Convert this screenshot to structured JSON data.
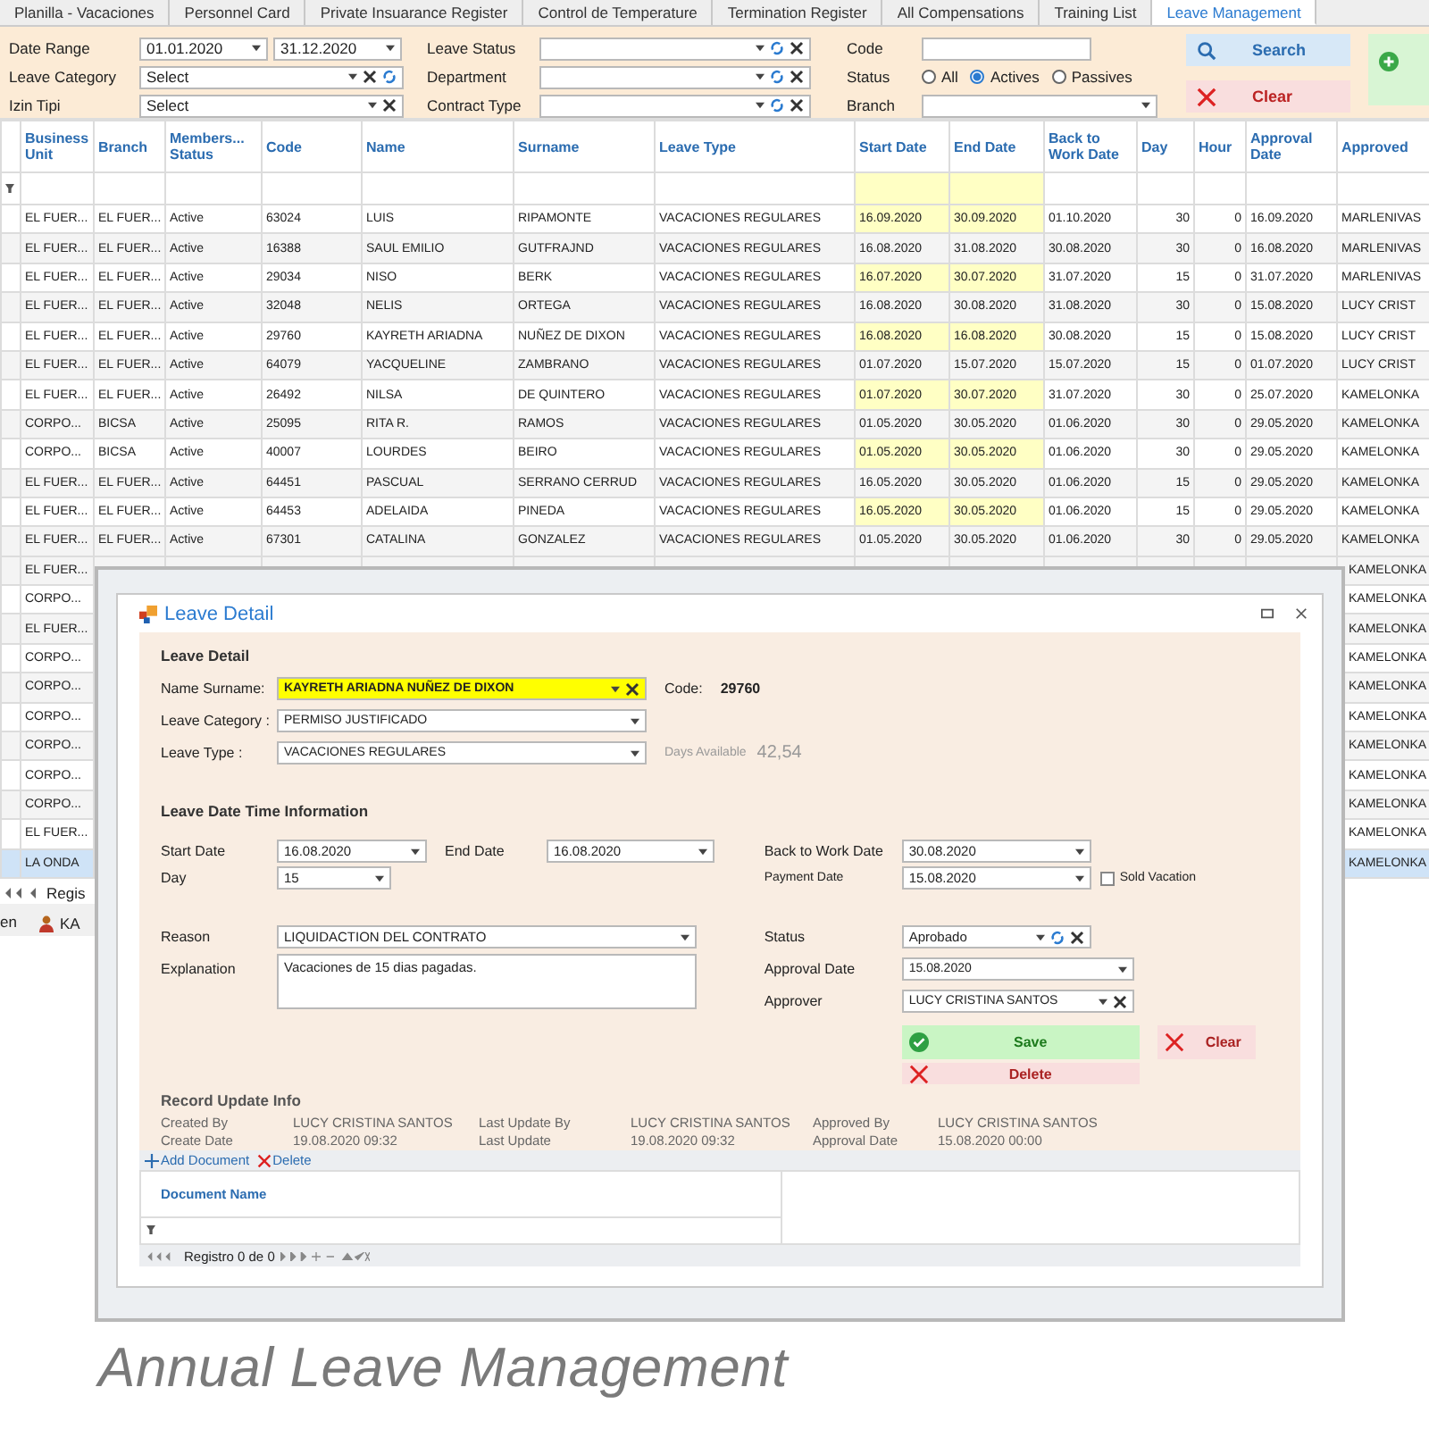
{
  "tabs": [
    {
      "label": "Planilla - Vacaciones",
      "selected": false
    },
    {
      "label": "Personnel Card",
      "selected": false
    },
    {
      "label": "Private Insuarance Register",
      "selected": false
    },
    {
      "label": "Control de Temperature",
      "selected": false
    },
    {
      "label": "Termination Register",
      "selected": false
    },
    {
      "label": "All Compensations",
      "selected": false
    },
    {
      "label": "Training List",
      "selected": false
    },
    {
      "label": "Leave Management",
      "selected": true
    }
  ],
  "filters": {
    "date_range": {
      "label": "Date Range",
      "from": "01.01.2020",
      "to": "31.12.2020"
    },
    "leave_category": {
      "label": "Leave Category",
      "placeholder": "Select"
    },
    "izin_tipi": {
      "label": "Izin Tipi",
      "placeholder": "Select"
    },
    "leave_status": {
      "label": "Leave Status"
    },
    "department": {
      "label": "Department"
    },
    "contract_type": {
      "label": "Contract Type"
    },
    "code": {
      "label": "Code"
    },
    "status": {
      "label": "Status",
      "options": [
        {
          "label": "All",
          "selected": false
        },
        {
          "label": "Actives",
          "selected": true
        },
        {
          "label": "Passives",
          "selected": false
        }
      ]
    },
    "branch": {
      "label": "Branch"
    },
    "search_button": "Search",
    "clear_button": "Clear"
  },
  "table": {
    "columns": [
      "Business Unit",
      "Branch",
      "Members... Status",
      "Code",
      "Name",
      "Surname",
      "Leave Type",
      "Start Date",
      "End Date",
      "Back to Work Date",
      "Day",
      "Hour",
      "Approval Date",
      "Approved"
    ],
    "rows": [
      {
        "selected": false,
        "cells": [
          "EL FUER...",
          "EL FUER...",
          "Active",
          "63024",
          "LUIS",
          "RIPAMONTE",
          "VACACIONES REGULARES",
          "16.09.2020",
          "30.09.2020",
          "01.10.2020",
          "30",
          "0",
          "16.09.2020",
          "MARLENIVAS"
        ]
      },
      {
        "selected": false,
        "cells": [
          "EL FUER...",
          "EL FUER...",
          "Active",
          "16388",
          "SAUL EMILIO",
          "GUTFRAJND",
          "VACACIONES REGULARES",
          "16.08.2020",
          "31.08.2020",
          "30.08.2020",
          "30",
          "0",
          "16.08.2020",
          "MARLENIVAS"
        ]
      },
      {
        "selected": false,
        "cells": [
          "EL FUER...",
          "EL FUER...",
          "Active",
          "29034",
          "NISO",
          "BERK",
          "VACACIONES REGULARES",
          "16.07.2020",
          "30.07.2020",
          "31.07.2020",
          "15",
          "0",
          "31.07.2020",
          "MARLENIVAS"
        ]
      },
      {
        "selected": false,
        "cells": [
          "EL FUER...",
          "EL FUER...",
          "Active",
          "32048",
          "NELIS",
          "ORTEGA",
          "VACACIONES REGULARES",
          "16.08.2020",
          "30.08.2020",
          "31.08.2020",
          "30",
          "0",
          "15.08.2020",
          "LUCY CRIST"
        ]
      },
      {
        "selected": false,
        "cells": [
          "EL FUER...",
          "EL FUER...",
          "Active",
          "29760",
          "KAYRETH ARIADNA",
          "NUÑEZ DE DIXON",
          "VACACIONES REGULARES",
          "16.08.2020",
          "16.08.2020",
          "30.08.2020",
          "15",
          "0",
          "15.08.2020",
          "LUCY CRIST"
        ]
      },
      {
        "selected": false,
        "cells": [
          "EL FUER...",
          "EL FUER...",
          "Active",
          "64079",
          "YACQUELINE",
          "ZAMBRANO",
          "VACACIONES REGULARES",
          "01.07.2020",
          "15.07.2020",
          "15.07.2020",
          "15",
          "0",
          "01.07.2020",
          "LUCY CRIST"
        ]
      },
      {
        "selected": false,
        "cells": [
          "EL FUER...",
          "EL FUER...",
          "Active",
          "26492",
          "NILSA",
          "DE QUINTERO",
          "VACACIONES REGULARES",
          "01.07.2020",
          "30.07.2020",
          "31.07.2020",
          "30",
          "0",
          "25.07.2020",
          "KAMELONKA"
        ]
      },
      {
        "selected": false,
        "cells": [
          "CORPO...",
          "BICSA",
          "Active",
          "25095",
          "RITA R.",
          "RAMOS",
          "VACACIONES REGULARES",
          "01.05.2020",
          "30.05.2020",
          "01.06.2020",
          "30",
          "0",
          "29.05.2020",
          "KAMELONKA"
        ]
      },
      {
        "selected": false,
        "cells": [
          "CORPO...",
          "BICSA",
          "Active",
          "40007",
          "LOURDES",
          "BEIRO",
          "VACACIONES REGULARES",
          "01.05.2020",
          "30.05.2020",
          "01.06.2020",
          "30",
          "0",
          "29.05.2020",
          "KAMELONKA"
        ]
      },
      {
        "selected": false,
        "cells": [
          "EL FUER...",
          "EL FUER...",
          "Active",
          "64451",
          "PASCUAL",
          "SERRANO CERRUD",
          "VACACIONES REGULARES",
          "16.05.2020",
          "30.05.2020",
          "01.06.2020",
          "15",
          "0",
          "29.05.2020",
          "KAMELONKA"
        ]
      },
      {
        "selected": false,
        "cells": [
          "EL FUER...",
          "EL FUER...",
          "Active",
          "64453",
          "ADELAIDA",
          "PINEDA",
          "VACACIONES REGULARES",
          "16.05.2020",
          "30.05.2020",
          "01.06.2020",
          "15",
          "0",
          "29.05.2020",
          "KAMELONKA"
        ]
      },
      {
        "selected": false,
        "cells": [
          "EL FUER...",
          "EL FUER...",
          "Active",
          "67301",
          "CATALINA",
          "GONZALEZ",
          "VACACIONES REGULARES",
          "01.05.2020",
          "30.05.2020",
          "01.06.2020",
          "30",
          "0",
          "29.05.2020",
          "KAMELONKA"
        ]
      }
    ],
    "covered_rows": [
      {
        "business_unit": "EL FUER...",
        "approved_by": "KAMELONKA",
        "selected": false
      },
      {
        "business_unit": "CORPO...",
        "approved_by": "KAMELONKA",
        "selected": false
      },
      {
        "business_unit": "EL FUER...",
        "approved_by": "KAMELONKA",
        "selected": false
      },
      {
        "business_unit": "CORPO...",
        "approved_by": "KAMELONKA",
        "selected": false
      },
      {
        "business_unit": "CORPO...",
        "approved_by": "KAMELONKA",
        "selected": false
      },
      {
        "business_unit": "CORPO...",
        "approved_by": "KAMELONKA",
        "selected": false
      },
      {
        "business_unit": "CORPO...",
        "approved_by": "KAMELONKA",
        "selected": false
      },
      {
        "business_unit": "CORPO...",
        "approved_by": "KAMELONKA",
        "selected": false
      },
      {
        "business_unit": "CORPO...",
        "approved_by": "KAMELONKA",
        "selected": false
      },
      {
        "business_unit": "EL FUER...",
        "approved_by": "KAMELONKA",
        "selected": false
      },
      {
        "business_unit": "LA ONDA",
        "approved_by": "KAMELONKA",
        "selected": true
      }
    ]
  },
  "navigator": "Regis",
  "taskbar": {
    "left": "en",
    "user": "KA"
  },
  "dialog": {
    "title": "Leave Detail",
    "section_1": "Leave Detail",
    "name": {
      "label": "Name Surname:",
      "value": "KAYRETH ARIADNA NUÑEZ DE DIXON"
    },
    "code": {
      "label": "Code:",
      "value": "29760"
    },
    "leave_category": {
      "label": "Leave Category :",
      "value": "PERMISO JUSTIFICADO"
    },
    "leave_type": {
      "label": "Leave Type :",
      "value": "VACACIONES REGULARES"
    },
    "days_available": {
      "label": "Days Available",
      "value": "42,54"
    },
    "section_2": "Leave Date Time Information",
    "start_date": {
      "label": "Start Date",
      "value": "16.08.2020"
    },
    "end_date": {
      "label": "End Date",
      "value": "16.08.2020"
    },
    "day": {
      "label": "Day",
      "value": "15"
    },
    "back_to_work": {
      "label": "Back to Work Date",
      "value": "30.08.2020"
    },
    "payment_date": {
      "label": "Payment Date",
      "value": "15.08.2020"
    },
    "sold_vacation": {
      "label": "Sold Vacation",
      "checked": false
    },
    "reason": {
      "label": "Reason",
      "value": "LIQUIDACTION DEL CONTRATO"
    },
    "explanation": {
      "label": "Explanation",
      "value": "Vacaciones de 15 dias pagadas."
    },
    "status": {
      "label": "Status",
      "value": "Aprobado"
    },
    "approval_date": {
      "label": "Approval Date",
      "value": "15.08.2020"
    },
    "approver": {
      "label": "Approver",
      "value": "LUCY CRISTINA SANTOS"
    },
    "save_button": "Save",
    "clear_button": "Clear",
    "delete_button": "Delete",
    "section_3": "Record Update Info",
    "record_info": [
      [
        {
          "label": "Created By",
          "value": "LUCY CRISTINA SANTOS"
        },
        {
          "label": "Create Date",
          "value": "19.08.2020 09:32"
        }
      ],
      [
        {
          "label": "Last Update By",
          "value": "LUCY CRISTINA SANTOS"
        },
        {
          "label": "Last Update",
          "value": "19.08.2020 09:32"
        }
      ],
      [
        {
          "label": "Approved By",
          "value": "LUCY CRISTINA SANTOS"
        },
        {
          "label": "Approval Date",
          "value": "15.08.2020 00:00"
        }
      ]
    ],
    "add_document": "Add Document",
    "delete_document": "Delete",
    "document_column": "Document Name",
    "navigator": "Registro 0 de 0"
  },
  "caption": "Annual Leave Management"
}
